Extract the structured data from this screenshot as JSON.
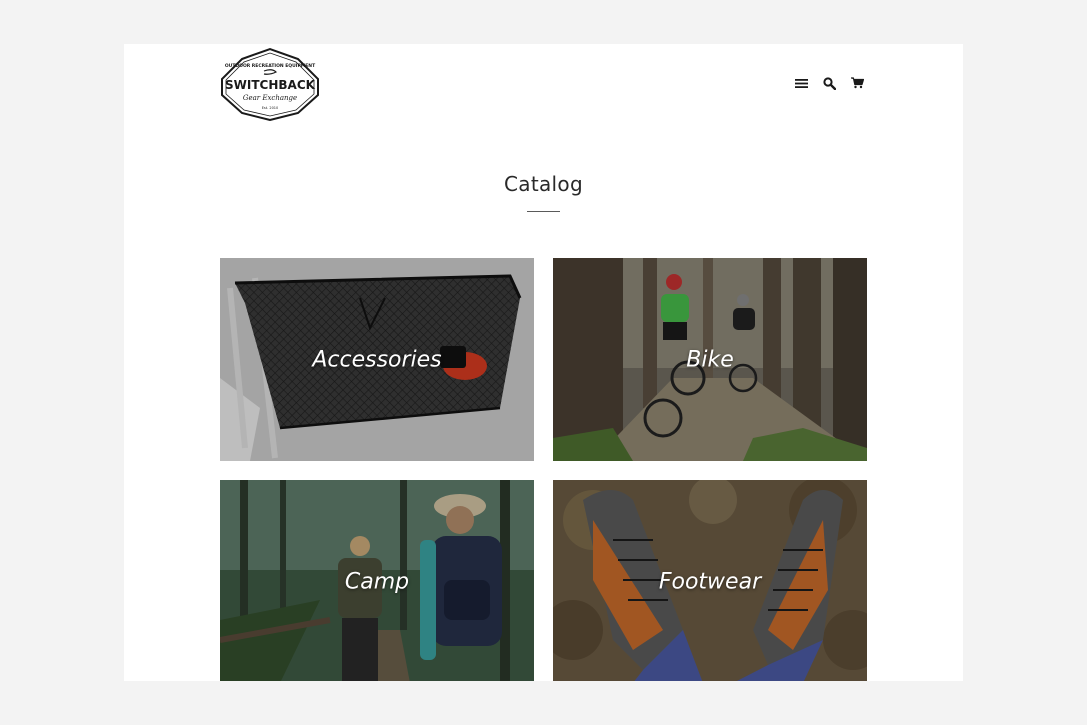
{
  "logo": {
    "top_text": "OUTDOOR RECREATION EQUIPMENT",
    "name": "SWITCHBACK",
    "tagline": "Gear Exchange",
    "est": "Est. 2010"
  },
  "header": {
    "icons": [
      "menu-icon",
      "search-icon",
      "cart-icon"
    ]
  },
  "page_title": "Catalog",
  "collections": [
    {
      "label": "Accessories",
      "image": "bike-basket-photo"
    },
    {
      "label": "Bike",
      "image": "mountain-bikers-forest-photo"
    },
    {
      "label": "Camp",
      "image": "hikers-forest-photo"
    },
    {
      "label": "Footwear",
      "image": "hiking-boots-photo"
    }
  ],
  "colors": {
    "background": "#f3f3f3",
    "page": "#ffffff",
    "text": "#2a2a2a",
    "tile_label": "#ffffff"
  }
}
